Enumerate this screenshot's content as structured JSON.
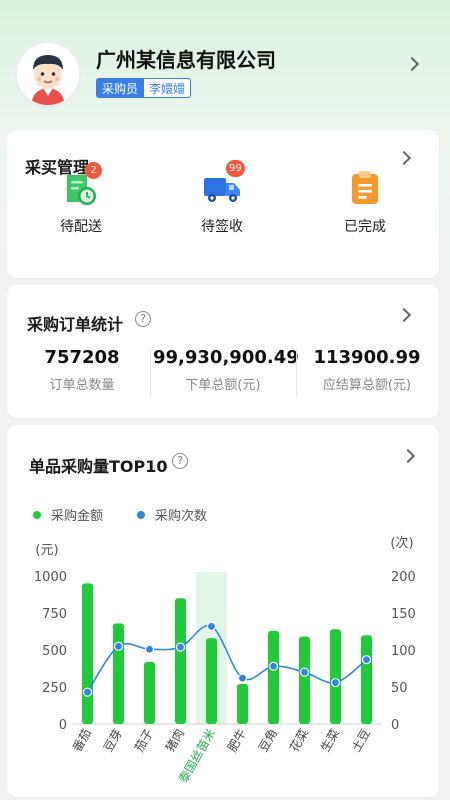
{
  "header": {
    "company": "广州某信息有限公司",
    "role": "采购员",
    "user": "李嬛嬛"
  },
  "purchase": {
    "title": "采买管理",
    "items": [
      {
        "label": "待配送",
        "icon": "pending-delivery-icon",
        "badge": "2"
      },
      {
        "label": "待签收",
        "icon": "truck-icon",
        "badge": "99"
      },
      {
        "label": "已完成",
        "icon": "clipboard-icon",
        "badge": ""
      }
    ]
  },
  "stats": {
    "title": "采购订单统计",
    "items": [
      {
        "value": "757208",
        "label": "订单总数量"
      },
      {
        "value": "99,930,900.49",
        "label": "下单总额(元)"
      },
      {
        "value": "113900.99",
        "label": "应结算总额(元)"
      }
    ]
  },
  "top10": {
    "title": "单品采购量TOP10",
    "legend": [
      "采购金额",
      "采购次数"
    ]
  },
  "colors": {
    "accent_green": "#22c93b",
    "accent_blue": "#2f86e0",
    "highlight": "#e3f5e6",
    "badge_red": "#f05a3a",
    "role_badge": "#3b7ee8"
  },
  "chart_data": {
    "type": "bar",
    "categories": [
      "番茄",
      "豆芽",
      "茄子",
      "猪肉",
      "泰国丝苗米",
      "肥牛",
      "豆角",
      "花菜",
      "生菜",
      "土豆"
    ],
    "highlight_category": "泰国丝苗米",
    "series": [
      {
        "name": "采购金额",
        "type": "bar",
        "axis": "left",
        "values": [
          950,
          680,
          420,
          850,
          580,
          270,
          630,
          590,
          640,
          600
        ]
      },
      {
        "name": "采购次数",
        "type": "line",
        "axis": "right",
        "values": [
          43,
          105,
          101,
          104,
          132,
          62,
          78,
          70,
          56,
          87
        ]
      }
    ],
    "ylabel_left": "(元)",
    "ylabel_right": "(次)",
    "ylim_left": [
      0,
      1000
    ],
    "ylim_right": [
      0,
      200
    ],
    "yticks_left": [
      "0",
      "250",
      "500",
      "750",
      "1000"
    ],
    "yticks_right": [
      "0",
      "50",
      "100",
      "150",
      "200"
    ],
    "grid": false,
    "legend_position": "top-left"
  }
}
